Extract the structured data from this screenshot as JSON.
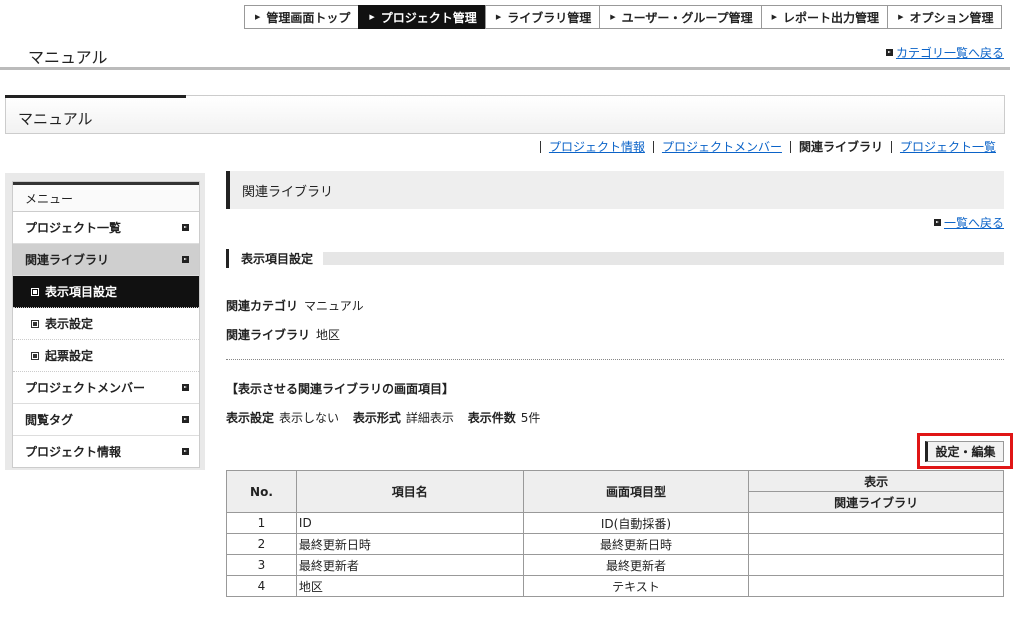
{
  "nav": {
    "items": [
      {
        "label": "管理画面トップ",
        "active": false
      },
      {
        "label": "プロジェクト管理",
        "active": true
      },
      {
        "label": "ライブラリ管理",
        "active": false
      },
      {
        "label": "ユーザー・グループ管理",
        "active": false
      },
      {
        "label": "レポート出力管理",
        "active": false
      },
      {
        "label": "オプション管理",
        "active": false
      }
    ]
  },
  "header": {
    "title": "マニュアル",
    "back_link": "カテゴリ一覧へ戻る"
  },
  "section": {
    "title": "マニュアル"
  },
  "tabs": [
    {
      "label": "プロジェクト情報",
      "current": false
    },
    {
      "label": "プロジェクトメンバー",
      "current": false
    },
    {
      "label": "関連ライブラリ",
      "current": true
    },
    {
      "label": "プロジェクト一覧",
      "current": false
    }
  ],
  "sidebar": {
    "heading": "メニュー",
    "items": [
      {
        "label": "プロジェクト一覧"
      },
      {
        "label": "関連ライブラリ"
      },
      {
        "label": "表示項目設定"
      },
      {
        "label": "表示設定"
      },
      {
        "label": "起票設定"
      },
      {
        "label": "プロジェクトメンバー"
      },
      {
        "label": "閲覧タグ"
      },
      {
        "label": "プロジェクト情報"
      }
    ]
  },
  "main": {
    "title": "関連ライブラリ",
    "list_back": "一覧へ戻る",
    "sub_heading": "表示項目設定",
    "category_label": "関連カテゴリ",
    "category_value": "マニュアル",
    "library_label": "関連ライブラリ",
    "library_value": "地区",
    "bracket_title": "【表示させる関連ライブラリの画面項目】",
    "display": {
      "setting_label": "表示設定",
      "setting_value": "表示しない",
      "format_label": "表示形式",
      "format_value": "詳細表示",
      "count_label": "表示件数",
      "count_value": "5件"
    },
    "edit_button": "設定・編集"
  },
  "table": {
    "headers": {
      "no": "No.",
      "name": "項目名",
      "type": "画面項目型",
      "display": "表示",
      "display_sub": "関連ライブラリ"
    },
    "rows": [
      {
        "no": "1",
        "name": "ID",
        "type": "ID(自動採番)",
        "display": ""
      },
      {
        "no": "2",
        "name": "最終更新日時",
        "type": "最終更新日時",
        "display": ""
      },
      {
        "no": "3",
        "name": "最終更新者",
        "type": "最終更新者",
        "display": ""
      },
      {
        "no": "4",
        "name": "地区",
        "type": "テキスト",
        "display": ""
      }
    ]
  }
}
